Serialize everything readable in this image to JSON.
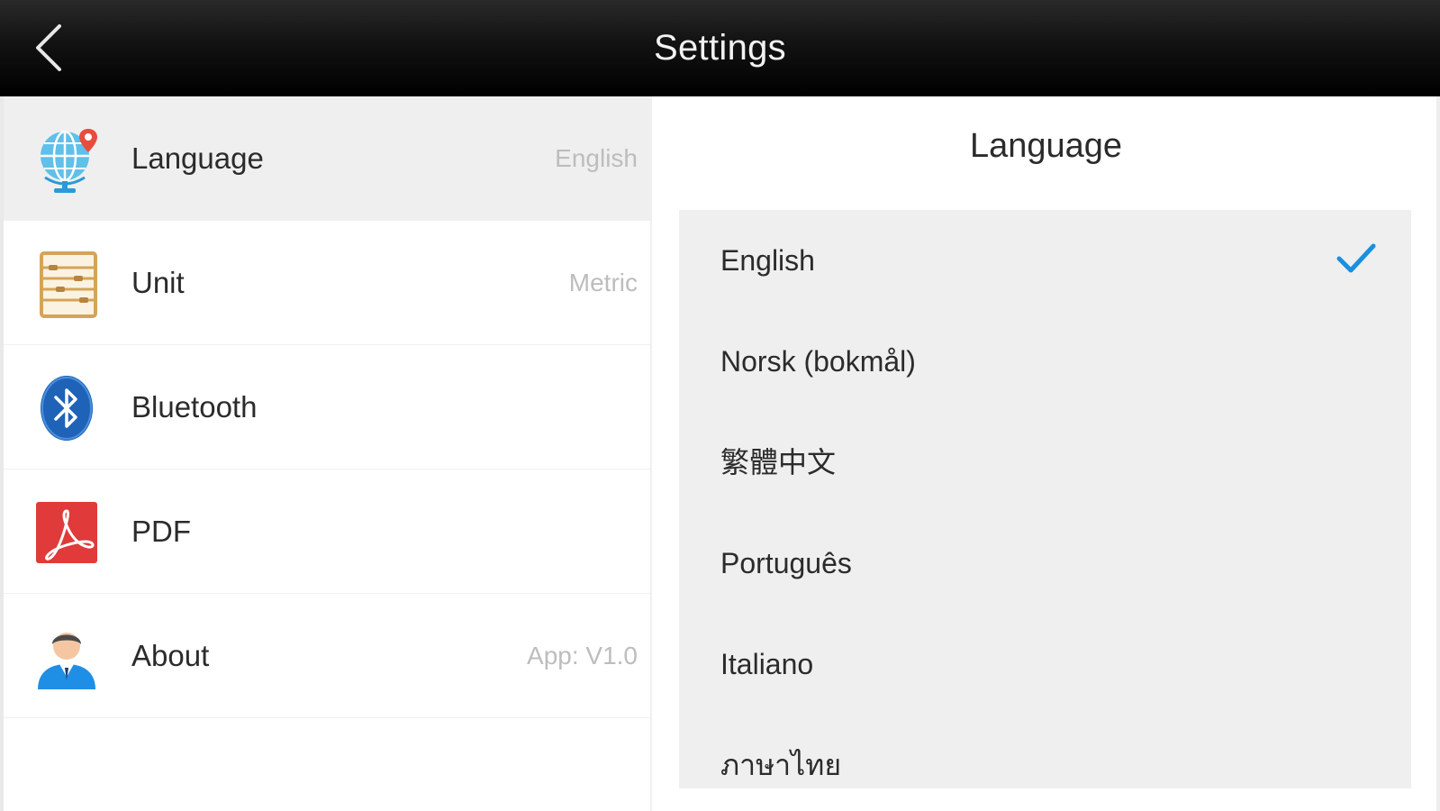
{
  "header": {
    "title": "Settings",
    "back_icon": "chevron-left-icon"
  },
  "sidebar": {
    "items": [
      {
        "label": "Language",
        "value": "English",
        "icon": "globe-icon",
        "selected": true
      },
      {
        "label": "Unit",
        "value": "Metric",
        "icon": "abacus-icon",
        "selected": false
      },
      {
        "label": "Bluetooth",
        "value": "",
        "icon": "bluetooth-icon",
        "selected": false
      },
      {
        "label": "PDF",
        "value": "",
        "icon": "pdf-icon",
        "selected": false
      },
      {
        "label": "About",
        "value": "App: V1.0",
        "icon": "user-icon",
        "selected": false
      }
    ]
  },
  "detail": {
    "title": "Language",
    "options": [
      {
        "label": "English",
        "checked": true
      },
      {
        "label": "Norsk (bokmål)",
        "checked": false
      },
      {
        "label": "繁體中文",
        "checked": false
      },
      {
        "label": "Português",
        "checked": false
      },
      {
        "label": "Italiano",
        "checked": false
      },
      {
        "label": "ภาษาไทย",
        "checked": false
      }
    ]
  },
  "colors": {
    "accent": "#1a8fe0",
    "titlebar": "#000000",
    "selected_row": "#efefef",
    "list_bg": "#efefef",
    "secondary_text": "#bdbdbd"
  }
}
